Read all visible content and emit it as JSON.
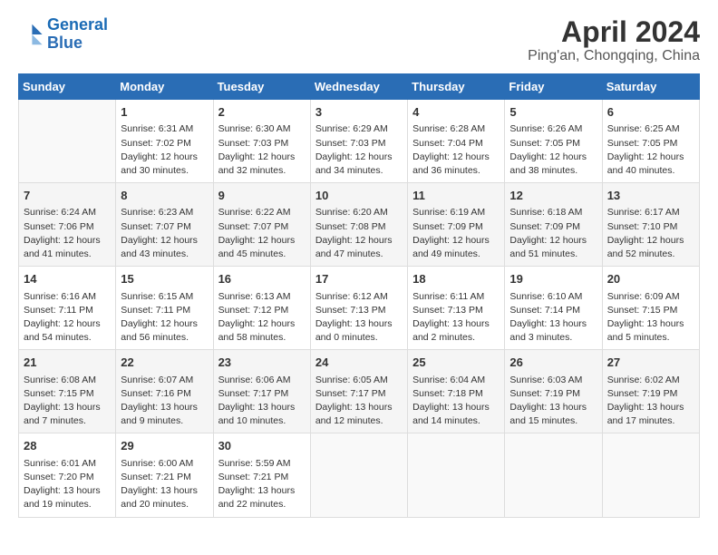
{
  "header": {
    "logo_line1": "General",
    "logo_line2": "Blue",
    "title": "April 2024",
    "subtitle": "Ping'an, Chongqing, China"
  },
  "calendar": {
    "days_of_week": [
      "Sunday",
      "Monday",
      "Tuesday",
      "Wednesday",
      "Thursday",
      "Friday",
      "Saturday"
    ],
    "weeks": [
      [
        {
          "day": "",
          "info": ""
        },
        {
          "day": "1",
          "info": "Sunrise: 6:31 AM\nSunset: 7:02 PM\nDaylight: 12 hours\nand 30 minutes."
        },
        {
          "day": "2",
          "info": "Sunrise: 6:30 AM\nSunset: 7:03 PM\nDaylight: 12 hours\nand 32 minutes."
        },
        {
          "day": "3",
          "info": "Sunrise: 6:29 AM\nSunset: 7:03 PM\nDaylight: 12 hours\nand 34 minutes."
        },
        {
          "day": "4",
          "info": "Sunrise: 6:28 AM\nSunset: 7:04 PM\nDaylight: 12 hours\nand 36 minutes."
        },
        {
          "day": "5",
          "info": "Sunrise: 6:26 AM\nSunset: 7:05 PM\nDaylight: 12 hours\nand 38 minutes."
        },
        {
          "day": "6",
          "info": "Sunrise: 6:25 AM\nSunset: 7:05 PM\nDaylight: 12 hours\nand 40 minutes."
        }
      ],
      [
        {
          "day": "7",
          "info": "Sunrise: 6:24 AM\nSunset: 7:06 PM\nDaylight: 12 hours\nand 41 minutes."
        },
        {
          "day": "8",
          "info": "Sunrise: 6:23 AM\nSunset: 7:07 PM\nDaylight: 12 hours\nand 43 minutes."
        },
        {
          "day": "9",
          "info": "Sunrise: 6:22 AM\nSunset: 7:07 PM\nDaylight: 12 hours\nand 45 minutes."
        },
        {
          "day": "10",
          "info": "Sunrise: 6:20 AM\nSunset: 7:08 PM\nDaylight: 12 hours\nand 47 minutes."
        },
        {
          "day": "11",
          "info": "Sunrise: 6:19 AM\nSunset: 7:09 PM\nDaylight: 12 hours\nand 49 minutes."
        },
        {
          "day": "12",
          "info": "Sunrise: 6:18 AM\nSunset: 7:09 PM\nDaylight: 12 hours\nand 51 minutes."
        },
        {
          "day": "13",
          "info": "Sunrise: 6:17 AM\nSunset: 7:10 PM\nDaylight: 12 hours\nand 52 minutes."
        }
      ],
      [
        {
          "day": "14",
          "info": "Sunrise: 6:16 AM\nSunset: 7:11 PM\nDaylight: 12 hours\nand 54 minutes."
        },
        {
          "day": "15",
          "info": "Sunrise: 6:15 AM\nSunset: 7:11 PM\nDaylight: 12 hours\nand 56 minutes."
        },
        {
          "day": "16",
          "info": "Sunrise: 6:13 AM\nSunset: 7:12 PM\nDaylight: 12 hours\nand 58 minutes."
        },
        {
          "day": "17",
          "info": "Sunrise: 6:12 AM\nSunset: 7:13 PM\nDaylight: 13 hours\nand 0 minutes."
        },
        {
          "day": "18",
          "info": "Sunrise: 6:11 AM\nSunset: 7:13 PM\nDaylight: 13 hours\nand 2 minutes."
        },
        {
          "day": "19",
          "info": "Sunrise: 6:10 AM\nSunset: 7:14 PM\nDaylight: 13 hours\nand 3 minutes."
        },
        {
          "day": "20",
          "info": "Sunrise: 6:09 AM\nSunset: 7:15 PM\nDaylight: 13 hours\nand 5 minutes."
        }
      ],
      [
        {
          "day": "21",
          "info": "Sunrise: 6:08 AM\nSunset: 7:15 PM\nDaylight: 13 hours\nand 7 minutes."
        },
        {
          "day": "22",
          "info": "Sunrise: 6:07 AM\nSunset: 7:16 PM\nDaylight: 13 hours\nand 9 minutes."
        },
        {
          "day": "23",
          "info": "Sunrise: 6:06 AM\nSunset: 7:17 PM\nDaylight: 13 hours\nand 10 minutes."
        },
        {
          "day": "24",
          "info": "Sunrise: 6:05 AM\nSunset: 7:17 PM\nDaylight: 13 hours\nand 12 minutes."
        },
        {
          "day": "25",
          "info": "Sunrise: 6:04 AM\nSunset: 7:18 PM\nDaylight: 13 hours\nand 14 minutes."
        },
        {
          "day": "26",
          "info": "Sunrise: 6:03 AM\nSunset: 7:19 PM\nDaylight: 13 hours\nand 15 minutes."
        },
        {
          "day": "27",
          "info": "Sunrise: 6:02 AM\nSunset: 7:19 PM\nDaylight: 13 hours\nand 17 minutes."
        }
      ],
      [
        {
          "day": "28",
          "info": "Sunrise: 6:01 AM\nSunset: 7:20 PM\nDaylight: 13 hours\nand 19 minutes."
        },
        {
          "day": "29",
          "info": "Sunrise: 6:00 AM\nSunset: 7:21 PM\nDaylight: 13 hours\nand 20 minutes."
        },
        {
          "day": "30",
          "info": "Sunrise: 5:59 AM\nSunset: 7:21 PM\nDaylight: 13 hours\nand 22 minutes."
        },
        {
          "day": "",
          "info": ""
        },
        {
          "day": "",
          "info": ""
        },
        {
          "day": "",
          "info": ""
        },
        {
          "day": "",
          "info": ""
        }
      ]
    ]
  }
}
